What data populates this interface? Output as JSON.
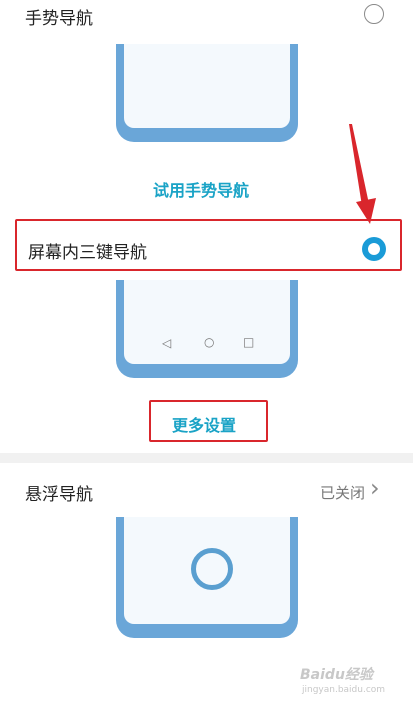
{
  "gesture_nav": {
    "title": "手势导航",
    "try_link": "试用手势导航"
  },
  "three_key_nav": {
    "title": "屏幕内三键导航",
    "more_settings": "更多设置",
    "nav_keys": [
      "◁",
      "○",
      "□"
    ]
  },
  "floating_nav": {
    "title": "悬浮导航",
    "status": "已关闭",
    "chevron": "›"
  },
  "watermark": {
    "brand": "Baidu经验",
    "url": "jingyan.baidu.com"
  },
  "colors": {
    "accent": "#1a9bd7",
    "link": "#1aa3c6",
    "annotation_red": "#d9262c",
    "phone_frame": "#6aa6d8"
  }
}
